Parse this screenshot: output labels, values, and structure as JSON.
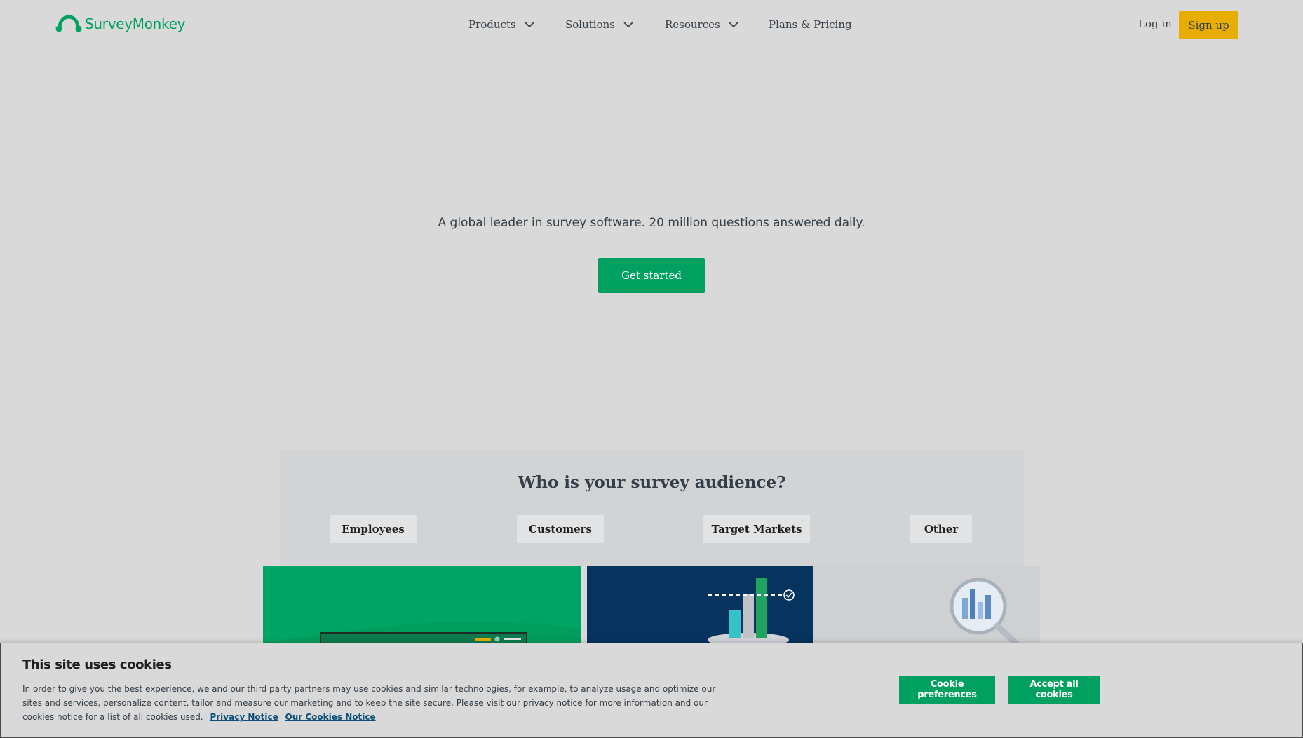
{
  "header": {
    "brand": "SurveyMonkey",
    "nav": [
      {
        "label": "Products"
      },
      {
        "label": "Solutions"
      },
      {
        "label": "Resources"
      },
      {
        "label": "Plans & Pricing"
      }
    ],
    "login_label": "Log in",
    "signup_label": "Sign up"
  },
  "hero": {
    "subtitle": "A global leader in survey software. 20 million questions answered daily.",
    "cta_label": "Get started"
  },
  "audience": {
    "title": "Who is your survey audience?",
    "options": [
      "Employees",
      "Customers",
      "Target Markets",
      "Other"
    ]
  },
  "cookie": {
    "title": "This site uses cookies",
    "text": "In order to give you the best experience, we and our third party partners may use cookies and similar technologies, for example, to analyze usage and optimize our sites and services, personalize content, tailor and measure our marketing and to keep the site secure. Please visit our privacy notice for more information and our cookies notice for a list of all cookies used.",
    "privacy_link": "Privacy Notice",
    "cookies_link": "Our Cookies Notice",
    "preferences_label": "Cookie preferences",
    "accept_label": "Accept all cookies"
  },
  "colors": {
    "brand_green": "#00a160",
    "signup_yellow": "#e7ad00",
    "card_blue": "#07335f"
  }
}
